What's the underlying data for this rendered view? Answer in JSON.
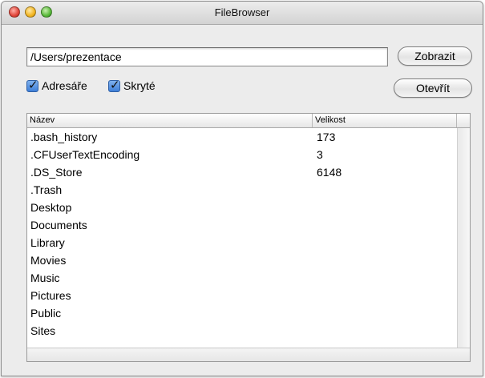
{
  "window": {
    "title": "FileBrowser"
  },
  "path": {
    "value": "/Users/prezentace"
  },
  "buttons": {
    "show_label": "Zobrazit",
    "open_label": "Otevřít"
  },
  "checkboxes": {
    "dirs_label": "Adresáře",
    "dirs_checked": true,
    "hidden_label": "Skryté",
    "hidden_checked": true
  },
  "table": {
    "headers": {
      "name": "Název",
      "size": "Velikost"
    },
    "rows": [
      {
        "name": ".bash_history",
        "size": "173"
      },
      {
        "name": ".CFUserTextEncoding",
        "size": "3"
      },
      {
        "name": ".DS_Store",
        "size": "6148"
      },
      {
        "name": ".Trash",
        "size": ""
      },
      {
        "name": "Desktop",
        "size": ""
      },
      {
        "name": "Documents",
        "size": ""
      },
      {
        "name": "Library",
        "size": ""
      },
      {
        "name": "Movies",
        "size": ""
      },
      {
        "name": "Music",
        "size": ""
      },
      {
        "name": "Pictures",
        "size": ""
      },
      {
        "name": "Public",
        "size": ""
      },
      {
        "name": "Sites",
        "size": ""
      }
    ]
  },
  "colors": {
    "window_bg": "#ececec",
    "checkbox_blue": "#3f7fd8",
    "close": "#e0463a",
    "minimize": "#f2b521",
    "maximize": "#59b93a"
  }
}
